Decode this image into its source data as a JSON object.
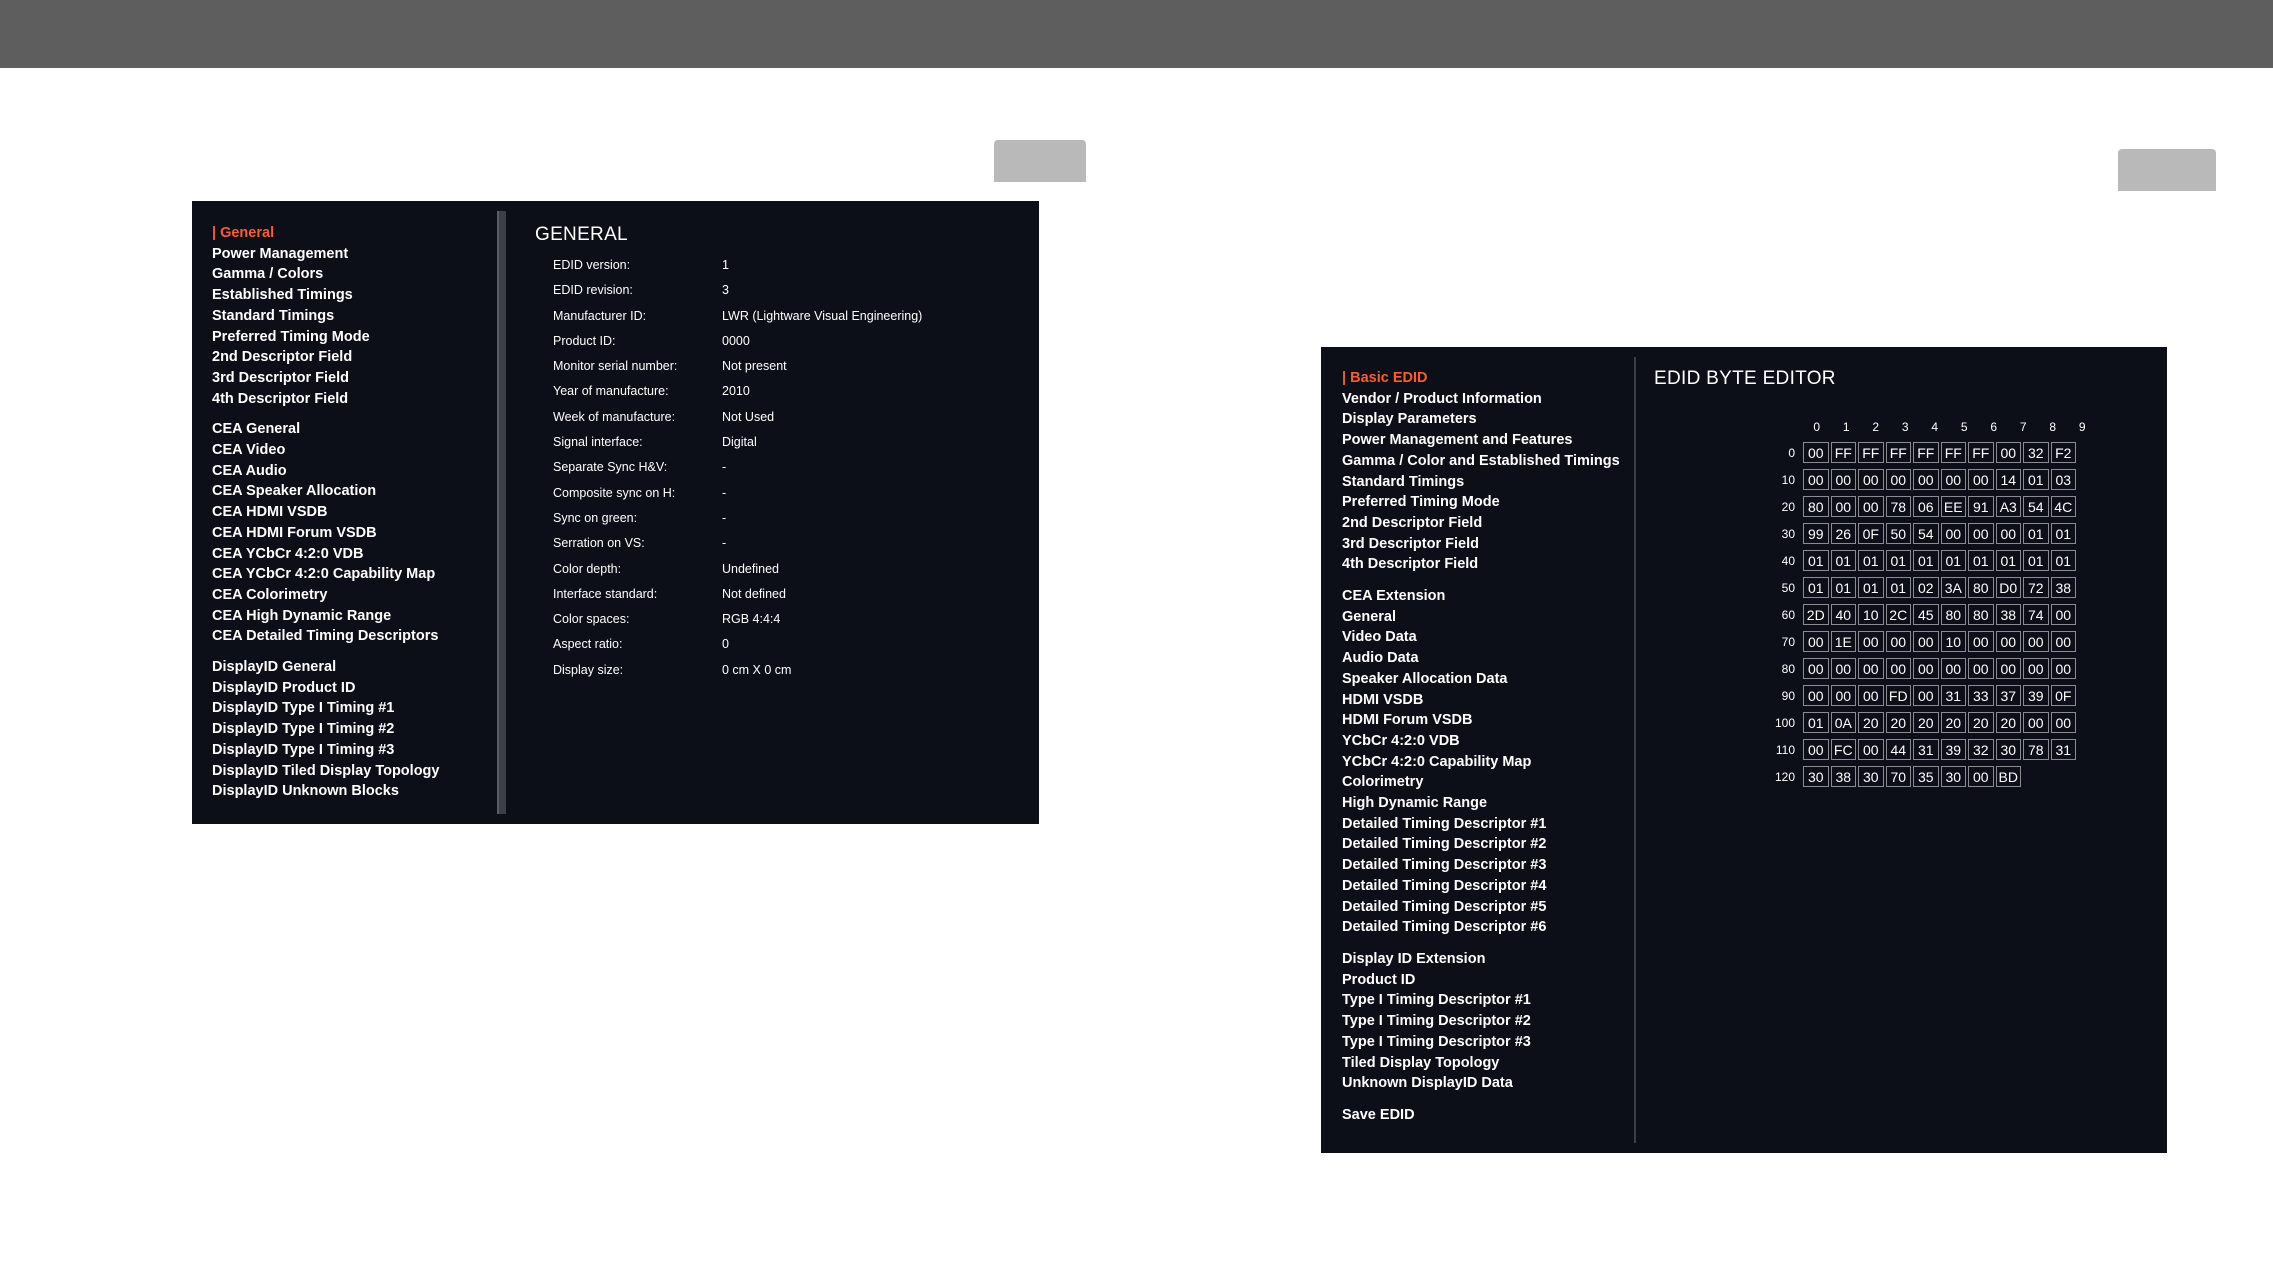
{
  "left": {
    "menu_groups": [
      [
        "General",
        "Power Management",
        "Gamma / Colors",
        "Established Timings",
        "Standard Timings",
        "Preferred Timing Mode",
        "2nd Descriptor Field",
        "3rd Descriptor Field",
        "4th Descriptor Field"
      ],
      [
        "CEA General",
        "CEA Video",
        "CEA Audio",
        "CEA Speaker Allocation",
        "CEA HDMI VSDB",
        "CEA HDMI Forum VSDB",
        "CEA YCbCr 4:2:0 VDB",
        "CEA YCbCr 4:2:0 Capability Map",
        "CEA Colorimetry",
        "CEA High Dynamic Range",
        "CEA Detailed Timing Descriptors"
      ],
      [
        "DisplayID General",
        "DisplayID Product ID",
        "DisplayID Type I Timing #1",
        "DisplayID Type I Timing #2",
        "DisplayID Type I Timing #3",
        "DisplayID Tiled Display Topology",
        "DisplayID Unknown Blocks"
      ]
    ],
    "active": "General",
    "title": "GENERAL",
    "properties": [
      {
        "label": "EDID version:",
        "value": "1"
      },
      {
        "label": "EDID revision:",
        "value": "3"
      },
      {
        "label": "Manufacturer ID:",
        "value": "LWR (Lightware Visual Engineering)"
      },
      {
        "label": "Product ID:",
        "value": "0000"
      },
      {
        "label": "Monitor serial number:",
        "value": "Not present"
      },
      {
        "label": "Year of manufacture:",
        "value": "2010"
      },
      {
        "label": "Week of manufacture:",
        "value": "Not Used"
      },
      {
        "label": "Signal interface:",
        "value": "Digital"
      },
      {
        "label": "Separate Sync H&V:",
        "value": "-"
      },
      {
        "label": "Composite sync on H:",
        "value": "-"
      },
      {
        "label": "Sync on green:",
        "value": "-"
      },
      {
        "label": "Serration on VS:",
        "value": "-"
      },
      {
        "label": "Color depth:",
        "value": "Undefined"
      },
      {
        "label": "Interface standard:",
        "value": "Not defined"
      },
      {
        "label": "Color spaces:",
        "value": "RGB 4:4:4"
      },
      {
        "label": "Aspect ratio:",
        "value": "0"
      },
      {
        "label": "Display size:",
        "value": "0 cm X 0 cm"
      }
    ]
  },
  "right": {
    "menu_groups": [
      [
        "Basic EDID",
        "Vendor / Product Information",
        "Display Parameters",
        "Power Management and Features",
        "Gamma / Color and Established Timings",
        "Standard Timings",
        "Preferred Timing Mode",
        "2nd Descriptor Field",
        "3rd Descriptor Field",
        "4th Descriptor Field"
      ],
      [
        "CEA Extension",
        "General",
        "Video Data",
        "Audio Data",
        "Speaker Allocation Data",
        "HDMI VSDB",
        "HDMI Forum VSDB",
        "YCbCr 4:2:0 VDB",
        "YCbCr 4:2:0 Capability Map",
        "Colorimetry",
        "High Dynamic Range",
        "Detailed Timing Descriptor #1",
        "Detailed Timing Descriptor #2",
        "Detailed Timing Descriptor #3",
        "Detailed Timing Descriptor #4",
        "Detailed Timing Descriptor #5",
        "Detailed Timing Descriptor #6"
      ],
      [
        "Display ID Extension",
        "Product ID",
        "Type I Timing Descriptor #1",
        "Type I Timing Descriptor #2",
        "Type I Timing Descriptor #3",
        "Tiled Display Topology",
        "Unknown DisplayID Data"
      ],
      [
        "Save EDID"
      ]
    ],
    "active": "Basic EDID",
    "title": "EDID BYTE EDITOR",
    "column_headers": [
      "0",
      "1",
      "2",
      "3",
      "4",
      "5",
      "6",
      "7",
      "8",
      "9"
    ],
    "rows": [
      {
        "label": "0",
        "bytes": [
          "00",
          "FF",
          "FF",
          "FF",
          "FF",
          "FF",
          "FF",
          "00",
          "32",
          "F2"
        ]
      },
      {
        "label": "10",
        "bytes": [
          "00",
          "00",
          "00",
          "00",
          "00",
          "00",
          "00",
          "14",
          "01",
          "03"
        ]
      },
      {
        "label": "20",
        "bytes": [
          "80",
          "00",
          "00",
          "78",
          "06",
          "EE",
          "91",
          "A3",
          "54",
          "4C"
        ]
      },
      {
        "label": "30",
        "bytes": [
          "99",
          "26",
          "0F",
          "50",
          "54",
          "00",
          "00",
          "00",
          "01",
          "01"
        ]
      },
      {
        "label": "40",
        "bytes": [
          "01",
          "01",
          "01",
          "01",
          "01",
          "01",
          "01",
          "01",
          "01",
          "01"
        ]
      },
      {
        "label": "50",
        "bytes": [
          "01",
          "01",
          "01",
          "01",
          "02",
          "3A",
          "80",
          "D0",
          "72",
          "38"
        ]
      },
      {
        "label": "60",
        "bytes": [
          "2D",
          "40",
          "10",
          "2C",
          "45",
          "80",
          "80",
          "38",
          "74",
          "00"
        ]
      },
      {
        "label": "70",
        "bytes": [
          "00",
          "1E",
          "00",
          "00",
          "00",
          "10",
          "00",
          "00",
          "00",
          "00"
        ]
      },
      {
        "label": "80",
        "bytes": [
          "00",
          "00",
          "00",
          "00",
          "00",
          "00",
          "00",
          "00",
          "00",
          "00"
        ]
      },
      {
        "label": "90",
        "bytes": [
          "00",
          "00",
          "00",
          "FD",
          "00",
          "31",
          "33",
          "37",
          "39",
          "0F"
        ]
      },
      {
        "label": "100",
        "bytes": [
          "01",
          "0A",
          "20",
          "20",
          "20",
          "20",
          "20",
          "20",
          "00",
          "00"
        ]
      },
      {
        "label": "110",
        "bytes": [
          "00",
          "FC",
          "00",
          "44",
          "31",
          "39",
          "32",
          "30",
          "78",
          "31"
        ]
      },
      {
        "label": "120",
        "bytes": [
          "30",
          "38",
          "30",
          "70",
          "35",
          "30",
          "00",
          "BD"
        ]
      }
    ]
  },
  "colors": {
    "accent": "#ff5a2a",
    "panel_bg": "#0c0f18",
    "topbar": "#5e5e5e",
    "tab": "#b9b9b9"
  }
}
